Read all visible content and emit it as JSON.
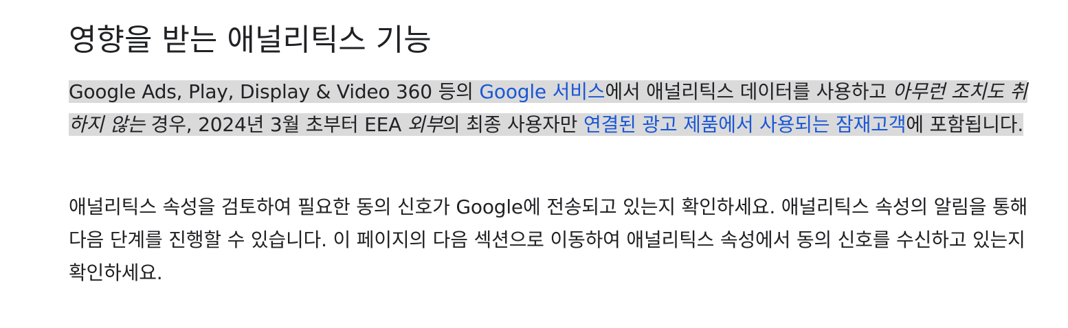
{
  "heading": "영향을 받는 애널리틱스 기능",
  "paragraph1": {
    "t1": "Google Ads, Play, Display & Video 360 등의 ",
    "link1": "Google 서비스",
    "t2": "에서 애널리틱스 데이터를 사용하고 ",
    "em1": "아무런 조치도 취하지 않는",
    "t3": " 경우, 2024년 3월 초부터 EEA ",
    "em2": "외부",
    "t4": "의 최종 사용자만 ",
    "link2": "연결된 광고 제품에서 사용되는 잠재고객",
    "t5": "에 포함됩니다."
  },
  "paragraph2": {
    "text": "애널리틱스 속성을 검토하여 필요한 동의 신호가 Google에 전송되고 있는지 확인하세요. 애널리틱스 속성의 알림을 통해 다음 단계를 진행할 수 있습니다. 이 페이지의 다음 섹션으로 이동하여 애널리틱스 속성에서 동의 신호를 수신하고 있는지 확인하세요."
  },
  "colors": {
    "text": "#202124",
    "link": "#1a57d6",
    "highlight": "#dadada"
  }
}
